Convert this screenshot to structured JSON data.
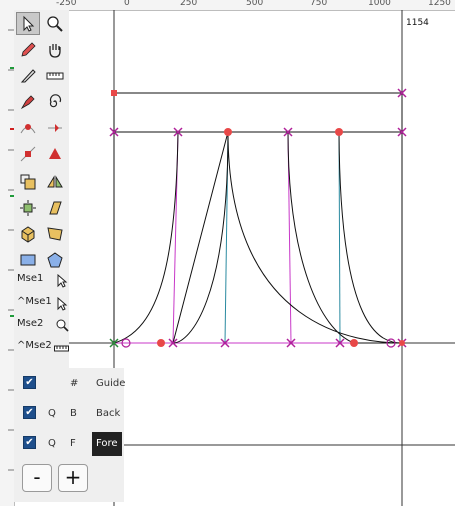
{
  "ruler": {
    "ticks": [
      "-250",
      "0",
      "250",
      "500",
      "750",
      "1000",
      "1250"
    ],
    "width_readout": "1154"
  },
  "toolbox": {
    "tools": [
      {
        "icon": "pointer-icon",
        "selected": true
      },
      {
        "icon": "magnify-icon"
      },
      {
        "icon": "pencil-icon"
      },
      {
        "icon": "hand-icon"
      },
      {
        "icon": "knife-icon"
      },
      {
        "icon": "ruler-icon"
      },
      {
        "icon": "pen-icon"
      },
      {
        "icon": "spiro-icon"
      },
      {
        "icon": "curve-point-icon"
      },
      {
        "icon": "tangent-point-icon"
      },
      {
        "icon": "corner-point-icon"
      },
      {
        "icon": "hv-curve-point-icon"
      },
      {
        "icon": "scale-icon"
      },
      {
        "icon": "flip-icon"
      },
      {
        "icon": "rotate-icon"
      },
      {
        "icon": "skew-icon"
      },
      {
        "icon": "3d-rotate-icon"
      },
      {
        "icon": "perspective-icon"
      },
      {
        "icon": "rectangle-icon"
      },
      {
        "icon": "polygon-icon"
      }
    ],
    "mouse_labels": [
      "Mse1",
      "^Mse1",
      "Mse2",
      "^Mse2"
    ]
  },
  "layers": {
    "rows": [
      {
        "checked": true,
        "q": "",
        "b": "#",
        "name": "Guide"
      },
      {
        "checked": true,
        "q": "Q",
        "b": "B",
        "name": "Back"
      },
      {
        "checked": true,
        "q": "Q",
        "b": "F",
        "name": "Fore",
        "active": true
      }
    ],
    "remove_label": "-",
    "add_label": "+"
  },
  "colors": {
    "outline": "#111111",
    "point_magenta": "#b0209a",
    "point_red": "#e84848",
    "control_line_magenta": "#c838c8",
    "control_line_teal": "#2a8aa0",
    "guide": "#333333",
    "ruler_bg": "#f4f4f4",
    "ruler_mark_green": "#1f9a3a",
    "ruler_mark_red": "#d02020"
  }
}
